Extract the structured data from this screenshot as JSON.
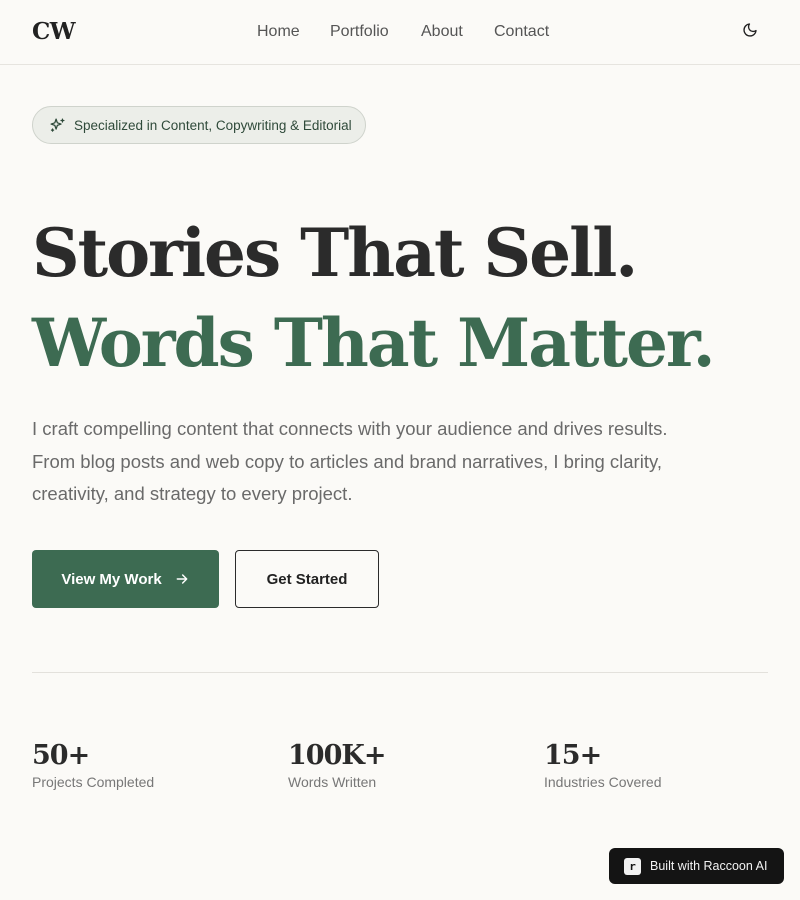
{
  "header": {
    "logo": "CW",
    "nav": [
      {
        "label": "Home"
      },
      {
        "label": "Portfolio"
      },
      {
        "label": "About"
      },
      {
        "label": "Contact"
      }
    ],
    "theme_icon": "moon-icon"
  },
  "badge": {
    "icon": "sparkles-icon",
    "text": "Specialized in Content, Copywriting & Editorial"
  },
  "hero": {
    "line1": "Stories That Sell.",
    "line2": "Words That Matter.",
    "intro": [
      "I craft compelling content that connects with your audience and drives results.",
      "From blog posts and web copy to articles and brand narratives, I bring clarity,",
      "creativity, and strategy to every project."
    ]
  },
  "buttons": {
    "primary": "View My Work",
    "primary_icon": "arrow-right-icon",
    "secondary": "Get Started"
  },
  "stats": [
    {
      "value": "50+",
      "label": "Projects Completed"
    },
    {
      "value": "100K+",
      "label": "Words Written"
    },
    {
      "value": "15+",
      "label": "Industries Covered"
    }
  ],
  "built_badge": {
    "logo": "r",
    "text": "Built with Raccoon AI"
  },
  "colors": {
    "background": "#fbfaf7",
    "accent": "#3d6b52",
    "text": "#2b2b2b",
    "muted": "#6a6a6a",
    "badge_bg": "#eceee9"
  }
}
